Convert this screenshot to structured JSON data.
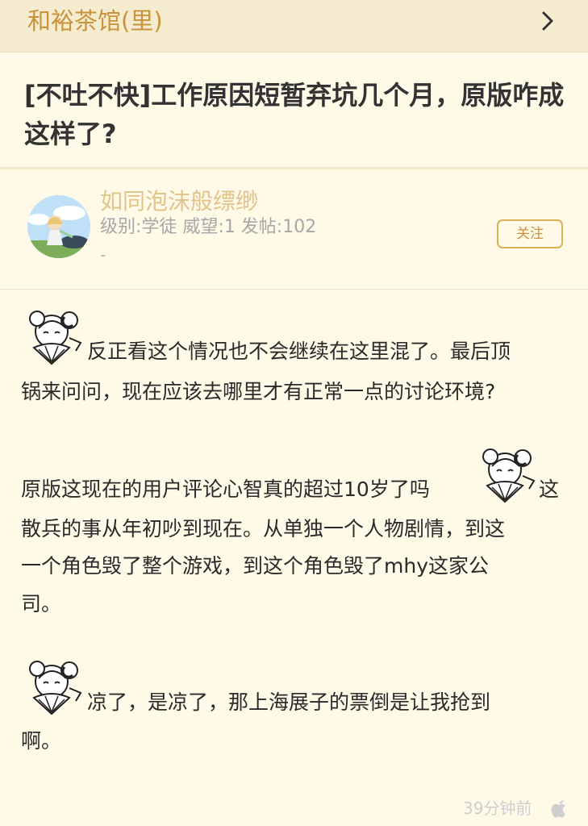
{
  "header": {
    "forum_name": "和裕茶馆(里)",
    "forward_icon": "chevron-right-icon"
  },
  "post": {
    "title": "[不吐不快]工作原因短暂弃坑几个月，原版咋成这样了?",
    "author": {
      "name": "如同泡沫般缥缈",
      "stats": "级别:学徒 威望:1 发帖:102",
      "signature": "-",
      "follow_label": "关注"
    },
    "paragraphs": [
      "反正看这个情况也不会继续在这里混了。最后顶",
      "锅来问问，现在应该去哪里才有正常一点的讨论环境?",
      "原版这现在的用户评论心智真的超过10岁了吗",
      "这",
      "散兵的事从年初吵到现在。从单独一个人物剧情，到这",
      "一个角色毁了整个游戏，到这个角色毁了mhy这家公",
      "司。",
      "凉了，是凉了，那上海展子的票倒是让我抢到",
      "啊。"
    ],
    "time": "39分钟前",
    "device_icon": "apple-icon"
  },
  "colors": {
    "background": "#fff9e8",
    "header_bg": "#f5ecd0",
    "accent": "#c8933a",
    "username": "#e0c48a"
  }
}
